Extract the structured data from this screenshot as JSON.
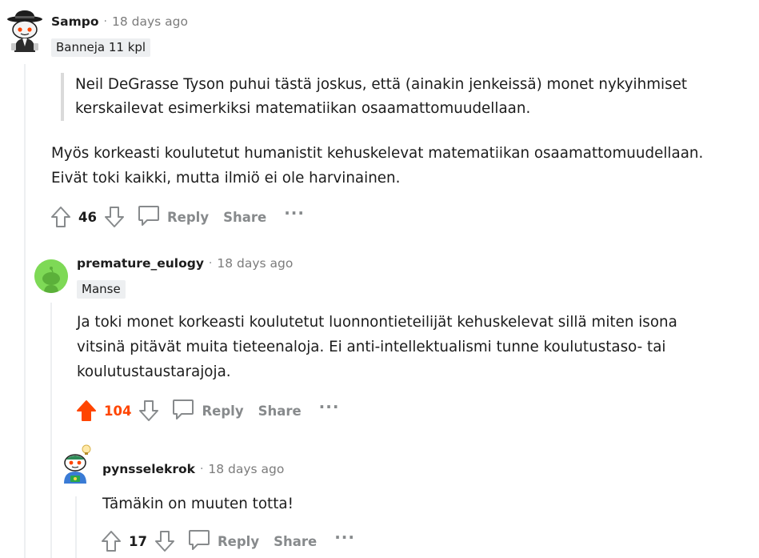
{
  "comments": [
    {
      "username": "Sampo",
      "separator": "·",
      "time": "18 days ago",
      "flair": "Banneja 11 kpl",
      "quote_lines": [
        "Neil DeGrasse Tyson puhui tästä joskus, että (ainakin jenkeissä) monet nykyihmiset",
        "kerskailevat esimerkiksi matematiikan osaamattomuudellaan."
      ],
      "body_lines": [
        "Myös korkeasti koulutetut humanistit kehuskelevat matematiikan osaamattomuudellaan.",
        "Eivät toki kaikki, mutta ilmiö ei ole harvinainen."
      ],
      "score": "46",
      "upvoted": false,
      "reply_label": "Reply",
      "share_label": "Share",
      "more_label": "···"
    },
    {
      "username": "premature_eulogy",
      "separator": "·",
      "time": "18 days ago",
      "flair": "Manse",
      "body_lines": [
        "Ja toki monet korkeasti koulutetut luonnontieteilijät kehuskelevat sillä miten isona",
        "vitsinä pitävät muita tieteenaloja. Ei anti-intellektualismi tunne koulutustaso- tai",
        "koulutustaustarajoja."
      ],
      "score": "104",
      "upvoted": true,
      "reply_label": "Reply",
      "share_label": "Share",
      "more_label": "···"
    },
    {
      "username": "pynsselekrok",
      "separator": "·",
      "time": "18 days ago",
      "body_lines": [
        "Tämäkin on muuten totta!"
      ],
      "score": "17",
      "upvoted": false,
      "reply_label": "Reply",
      "share_label": "Share",
      "more_label": "···"
    }
  ],
  "colors": {
    "upvote_active": "#ff4500",
    "meta_gray": "#878a8c",
    "thread_line": "#edeff1",
    "avatar_green": "#7ed956"
  },
  "icons": {
    "upvote": "arrow-up-icon",
    "downvote": "arrow-down-icon",
    "reply": "comment-bubble-icon",
    "more": "ellipsis-icon"
  }
}
